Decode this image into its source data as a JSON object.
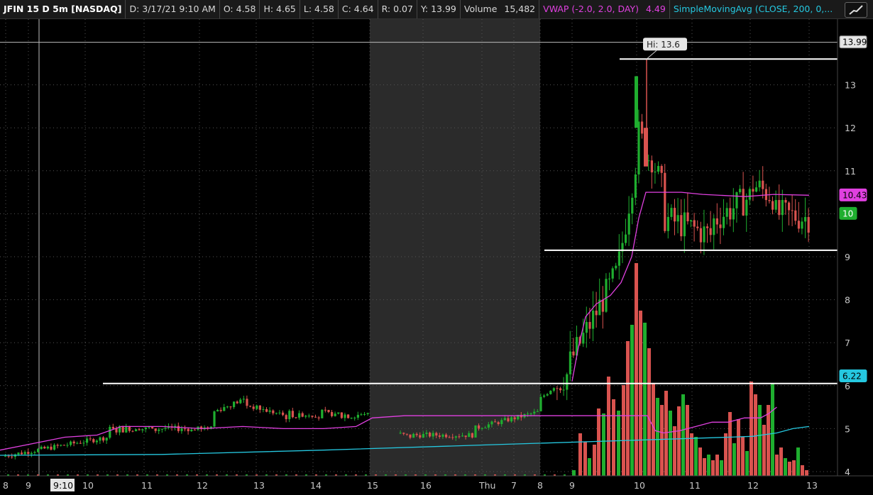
{
  "header": {
    "symbol": "JFIN 15 D 5m [NASDAQ]",
    "date": "D: 3/17/21 9:10 AM",
    "open": "O: 4.58",
    "high": "H: 4.65",
    "low": "L: 4.58",
    "close": "C: 4.64",
    "range": "R: 0.07",
    "y": "Y: 13.99",
    "volume_label": "Volume",
    "volume_value": "15,482",
    "vwap_label": "VWAP (-2.0, 2.0, DAY)",
    "vwap_value": "4.49",
    "sma_label": "SimpleMovingAvg (CLOSE, 200, 0,..."
  },
  "colors": {
    "up": "#1fae2f",
    "down": "#d9534f",
    "vwap": "#e040e0",
    "sma": "#25c8e0",
    "background": "#000000",
    "shaded": "#2b2b2b",
    "level_line": "#ffffff"
  },
  "icons": {
    "settings": "chart-style-icon"
  },
  "chart_data": {
    "type": "candlestick",
    "ylim": [
      4,
      14
    ],
    "y_ticks": [
      "4",
      "5",
      "6",
      "7",
      "8",
      "9",
      "10",
      "11",
      "12",
      "13"
    ],
    "x_ticks": [
      "8",
      "9",
      "9:10",
      "10",
      "11",
      "12",
      "13",
      "14",
      "15",
      "16",
      "Thu",
      "7",
      "8",
      "9",
      "10",
      "11",
      "12",
      "13"
    ],
    "shaded_session": "15 – 8 (after-hours / pre-market)",
    "hi_annotation": "Hi: 13.6",
    "price_labels": [
      {
        "text": "13.99",
        "value": 13.99,
        "kind": "cursor"
      },
      {
        "text": "10.43",
        "value": 10.43,
        "kind": "vwap"
      },
      {
        "text": "10",
        "value": 10.0,
        "kind": "last"
      },
      {
        "text": "6.22",
        "value": 6.22,
        "kind": "sma"
      }
    ],
    "levels": [
      {
        "value": 13.6,
        "from": "9:45",
        "to": "end"
      },
      {
        "value": 9.15,
        "from": "08:00",
        "to": "end"
      },
      {
        "value": 6.05,
        "from": "10:20",
        "to": "end"
      }
    ],
    "series": [
      {
        "name": "VWAP (-2.0, 2.0, DAY)",
        "points": [
          [
            0.0,
            4.5
          ],
          [
            0.04,
            4.65
          ],
          [
            0.08,
            4.8
          ],
          [
            0.12,
            4.85
          ],
          [
            0.15,
            5.05
          ],
          [
            0.2,
            5.05
          ],
          [
            0.25,
            5.0
          ],
          [
            0.3,
            5.05
          ],
          [
            0.35,
            5.0
          ],
          [
            0.4,
            5.0
          ],
          [
            0.44,
            5.05
          ],
          [
            0.46,
            5.25
          ],
          [
            0.5,
            5.3
          ],
          [
            0.55,
            5.3
          ],
          [
            0.6,
            5.3
          ],
          [
            0.65,
            5.3
          ],
          [
            0.7,
            5.3
          ],
          [
            0.75,
            5.3
          ],
          [
            0.79,
            5.3
          ],
          [
            0.8,
            5.3
          ],
          [
            0.81,
            4.95
          ],
          [
            0.82,
            4.9
          ],
          [
            0.84,
            4.95
          ],
          [
            0.86,
            5.05
          ],
          [
            0.88,
            5.15
          ],
          [
            0.9,
            5.15
          ],
          [
            0.92,
            5.25
          ],
          [
            0.94,
            5.25
          ],
          [
            0.95,
            5.35
          ],
          [
            0.96,
            5.5
          ]
        ]
      },
      {
        "name": "SimpleMovingAvg (CLOSE, 200, 0,...)",
        "points": [
          [
            0.0,
            4.38
          ],
          [
            0.2,
            4.4
          ],
          [
            0.4,
            4.5
          ],
          [
            0.6,
            4.62
          ],
          [
            0.8,
            4.74
          ],
          [
            0.9,
            4.8
          ],
          [
            0.93,
            4.82
          ],
          [
            0.96,
            4.9
          ],
          [
            0.98,
            5.0
          ],
          [
            1.0,
            5.05
          ]
        ]
      }
    ],
    "volume_note": "volume bars rise sharply after the 8 AM open on Thursday"
  }
}
